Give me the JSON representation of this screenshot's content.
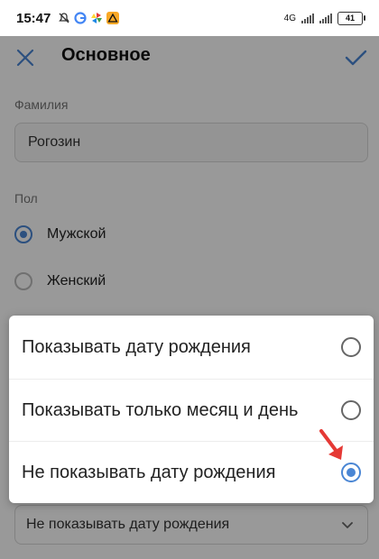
{
  "status_bar": {
    "time": "15:47",
    "network": "4G",
    "battery": "41",
    "icons": [
      "mute-bell-icon",
      "google-icon",
      "pinwheel-icon",
      "warning-icon"
    ]
  },
  "app_bar": {
    "title": "Основное",
    "close_icon": "close-icon",
    "confirm_icon": "check-icon",
    "accent": "#4a86d4"
  },
  "form": {
    "surname_label": "Фамилия",
    "surname_value": "Рогозин",
    "gender_label": "Пол",
    "gender_options": [
      {
        "label": "Мужской",
        "selected": true
      },
      {
        "label": "Женский",
        "selected": false
      }
    ],
    "birthday_display_value": "Не показывать дату рождения"
  },
  "dialog": {
    "options": [
      {
        "label": "Показывать дату рождения",
        "selected": false
      },
      {
        "label": "Показывать только месяц и день",
        "selected": false
      },
      {
        "label": "Не показывать дату рождения",
        "selected": true
      }
    ]
  },
  "annotation": {
    "icon": "red-arrow-icon",
    "color": "#e53935"
  }
}
